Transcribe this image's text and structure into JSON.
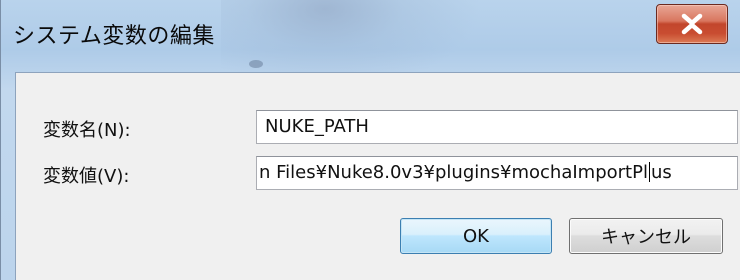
{
  "window": {
    "title": "システム変数の編集"
  },
  "titlebar": {
    "close_icon": "close-x-icon"
  },
  "form": {
    "name_label": "変数名(N):",
    "name_value": "NUKE_PATH",
    "value_label": "変数値(V):",
    "value_text_before_caret": "n Files¥Nuke8.0v3¥plugins¥mochaImportPl",
    "value_text_after_caret": "us"
  },
  "buttons": {
    "ok_label": "OK",
    "cancel_label": "キャンセル"
  },
  "colors": {
    "titlebar": "#b9d3ec",
    "close_button": "#c94d31",
    "dialog_body": "#f0f0f0",
    "ok_border": "#3c7fb1"
  }
}
